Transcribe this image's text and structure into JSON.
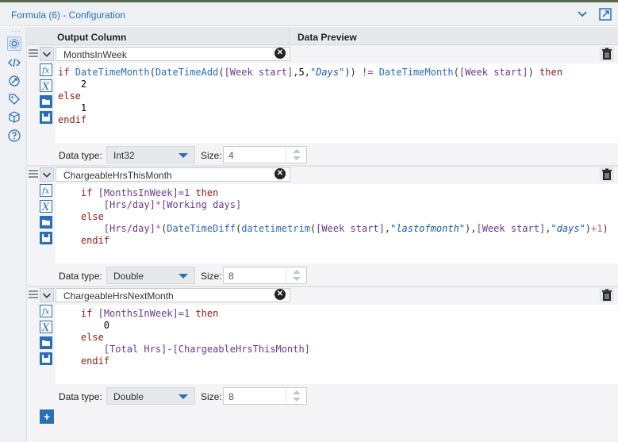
{
  "window": {
    "title": "Formula (6) - Configuration"
  },
  "columns": {
    "output": "Output Column",
    "preview": "Data Preview"
  },
  "formulas": [
    {
      "name": "MonthsInWeek",
      "data_type_label": "Data type:",
      "data_type": "Int32",
      "size_label": "Size:",
      "size": "4"
    },
    {
      "name": "ChargeableHrsThisMonth",
      "data_type_label": "Data type:",
      "data_type": "Double",
      "size_label": "Size:",
      "size": "8"
    },
    {
      "name": "ChargeableHrsNextMonth",
      "data_type_label": "Data type:",
      "data_type": "Double",
      "size_label": "Size:",
      "size": "8"
    }
  ],
  "code": {
    "f1": {
      "if": "if",
      "then": "then",
      "else": "else",
      "endif": "endif",
      "fn_month1": "DateTimeMonth",
      "fn_add": "DateTimeAdd",
      "week_start1": "[Week start]",
      "five": "5",
      "days": "\"Days\"",
      "neq": "!=",
      "fn_month2": "DateTimeMonth",
      "week_start2": "[Week start]",
      "two": "2",
      "one": "1"
    },
    "f2": {
      "if": "if",
      "then": "then",
      "else": "else",
      "endif": "endif",
      "miw": "[MonthsInWeek]",
      "eq1": "=1",
      "hrsday1": "[Hrs/day]",
      "mul1": "*",
      "working": "[Working days]",
      "hrsday2": "[Hrs/day]",
      "mul2": "*",
      "diff": "DateTimeDiff",
      "trim": "datetimetrim",
      "ws1": "[Week start]",
      "lom": "\"lastofmonth\"",
      "ws2": "[Week start]",
      "days": "\"days\"",
      "plus1": "+1"
    },
    "f3": {
      "if": "if",
      "then": "then",
      "else": "else",
      "endif": "endif",
      "miw": "[MonthsInWeek]",
      "eq1": "=1",
      "zero": "0",
      "total": "[Total Hrs]",
      "minus": "-",
      "cht": "[ChargeableHrsThisMonth]"
    }
  },
  "icons": {
    "sidebar": [
      "gear-icon",
      "code-icon",
      "connection-icon",
      "tag-icon",
      "cube-icon",
      "help-icon"
    ],
    "tools": [
      "fx-icon",
      "variable-icon",
      "open-folder-icon",
      "save-icon"
    ]
  },
  "colors": {
    "accent": "#2b6fb3",
    "keyword": "#8b1a1a",
    "function": "#2a6bb5",
    "field": "#6a3a8a"
  }
}
